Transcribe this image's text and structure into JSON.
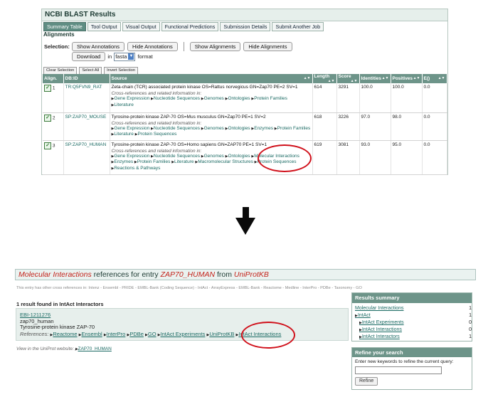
{
  "blast": {
    "title": "NCBI BLAST Results",
    "tabs": [
      "Summary Table",
      "Tool Output",
      "Visual Output",
      "Functional Predictions",
      "Submission Details",
      "Submit Another Job"
    ],
    "alignments_label": "Alignments",
    "selection_label": "Selection:",
    "buttons": {
      "show_annotations": "Show Annotations",
      "hide_annotations": "Hide Annotations",
      "show_alignments": "Show Alignments",
      "hide_alignments": "Hide Alignments",
      "download": "Download",
      "in": "in",
      "format_value": "fasta",
      "format": "format",
      "clear_selection": "Clear Selection",
      "select_all": "Select All",
      "invert_selection": "Invert Selection"
    },
    "columns": [
      "Align.",
      "DB:ID",
      "Source",
      "Length",
      "Score",
      "Identities",
      "Positives",
      "E()"
    ],
    "xref_title": "Cross-references and related information in:",
    "rows": [
      {
        "n": "1",
        "id": "TR:Q5FVN9_RAT",
        "source": "Zeta-chain (TCR) associated protein kinase OS=Rattus norvegicus GN=Zap70 PE=2 SV=1",
        "xrefs": [
          "Gene Expression",
          "Nucleotide Sequences",
          "Genomes",
          "Ontologies",
          "Protein Families",
          "Literature"
        ],
        "length": "614",
        "score": "3291",
        "identities": "100.0",
        "positives": "100.0",
        "e": "0.0"
      },
      {
        "n": "2",
        "id": "SP:ZAP70_MOUSE",
        "source": "Tyrosine-protein kinase ZAP-70 OS=Mus musculus GN=Zap70 PE=1 SV=2",
        "xrefs": [
          "Gene Expression",
          "Nucleotide Sequences",
          "Genomes",
          "Ontologies",
          "Enzymes",
          "Protein Families",
          "Literature",
          "Protein Sequences"
        ],
        "length": "618",
        "score": "3226",
        "identities": "97.0",
        "positives": "98.0",
        "e": "0.0"
      },
      {
        "n": "3",
        "id": "SP:ZAP70_HUMAN",
        "source": "Tyrosine-protein kinase ZAP-70 OS=Homo sapiens GN=ZAP70 PE=1 SV=1",
        "xrefs": [
          "Gene Expression",
          "Nucleotide Sequences",
          "Genomes",
          "Ontologies",
          "Molecular Interactions",
          "Enzymes",
          "Protein Families",
          "Literature",
          "Macromolecular Structures",
          "Protein Sequences",
          "Reactions & Pathways"
        ],
        "length": "619",
        "score": "3081",
        "identities": "93.0",
        "positives": "95.0",
        "e": "0.0"
      }
    ]
  },
  "mi": {
    "header": {
      "part1": "Molecular Interactions",
      "part2": " references for entry ",
      "part3": "ZAP70_HUMAN",
      "part4": " from ",
      "part5": "UniProtKB"
    },
    "xref_line": "This entry has other cross references in:  Intenz  -  Ensembl  -  PRIDE  -  EMBL-Bank (Coding Sequence)  -  IntAct  -  ArrayExpress  -  EMBL-Bank  -  Reactome  -  Medline  -  InterPro  -  PDBe  -  Taxonomy  -  GO",
    "found": "1 result found in IntAct Interactors",
    "entry": {
      "link": "EBI-1211276",
      "name": "zap70_human",
      "desc": "Tyrosine-protein kinase ZAP-70",
      "refs_label": "References:",
      "refs": [
        "Reactome",
        "Ensembl",
        "InterPro",
        "PDBe",
        "GO",
        "IntAct Experiments",
        "UniProtKB",
        "IntAct Interactions"
      ]
    },
    "view_line": "View in the UniProt website:",
    "view_link": "ZAP70_HUMAN",
    "summary": {
      "title": "Results summary",
      "rows": [
        {
          "label": "Molecular Interactions",
          "count": "1"
        },
        {
          "label": "IntAct",
          "count": "1"
        },
        {
          "label": "IntAct Experiments",
          "count": "0"
        },
        {
          "label": "IntAct Interactions",
          "count": "0"
        },
        {
          "label": "IntAct Interactors",
          "count": "1"
        }
      ]
    },
    "refine": {
      "title": "Refine your search",
      "text": "Enter new keywords to refine the current query:",
      "button": "Refine"
    }
  }
}
